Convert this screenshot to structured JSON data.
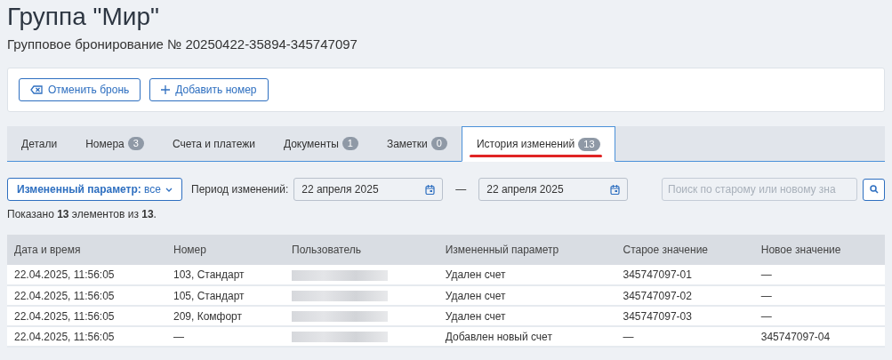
{
  "title": "Группа \"Мир\"",
  "subtitle": "Групповое бронирование № 20250422-35894-345747097",
  "actions": [
    {
      "kind": "cancel",
      "label": "Отменить бронь"
    },
    {
      "kind": "add",
      "label": "Добавить номер"
    }
  ],
  "tabs": [
    {
      "label": "Детали",
      "selected": false
    },
    {
      "label": "Номера",
      "count": "3",
      "selected": false
    },
    {
      "label": "Счета и платежи",
      "selected": false
    },
    {
      "label": "Документы",
      "count": "1",
      "selected": false
    },
    {
      "label": "Заметки",
      "count": "0",
      "selected": false
    },
    {
      "label": "История изменений",
      "count": "13",
      "selected": true
    }
  ],
  "filters": {
    "param_label": "Измененный параметр:",
    "param_value": "все",
    "period_label": "Период изменений:",
    "date_from": "22 апреля 2025",
    "separator": "—",
    "date_to": "22 апреля 2025",
    "search": {
      "placeholder": "Поиск по старому или новому зна"
    }
  },
  "summary": "Показано **13** элементов из **13**.",
  "table": {
    "columns": [
      "Дата и время",
      "Номер",
      "Пользователь",
      "Измененный параметр",
      "Старое значение",
      "Новое значение"
    ],
    "rows": [
      {
        "cells": [
          "22.04.2025, 11:56:05",
          "103, Стандарт",
          "",
          "Удален счет",
          "345747097-01",
          "—"
        ],
        "user_redacted": true
      },
      {
        "cells": [
          "22.04.2025, 11:56:05",
          "105, Стандарт",
          "",
          "Удален счет",
          "345747097-02",
          "—"
        ],
        "user_redacted": true
      },
      {
        "cells": [
          "22.04.2025, 11:56:05",
          "209, Комфорт",
          "",
          "Удален счет",
          "345747097-03",
          "—"
        ],
        "user_redacted": true
      },
      {
        "cells": [
          "22.04.2025, 11:56:05",
          "—",
          "",
          "Добавлен новый счет",
          "—",
          "345747097-04"
        ],
        "user_redacted": true
      }
    ]
  }
}
